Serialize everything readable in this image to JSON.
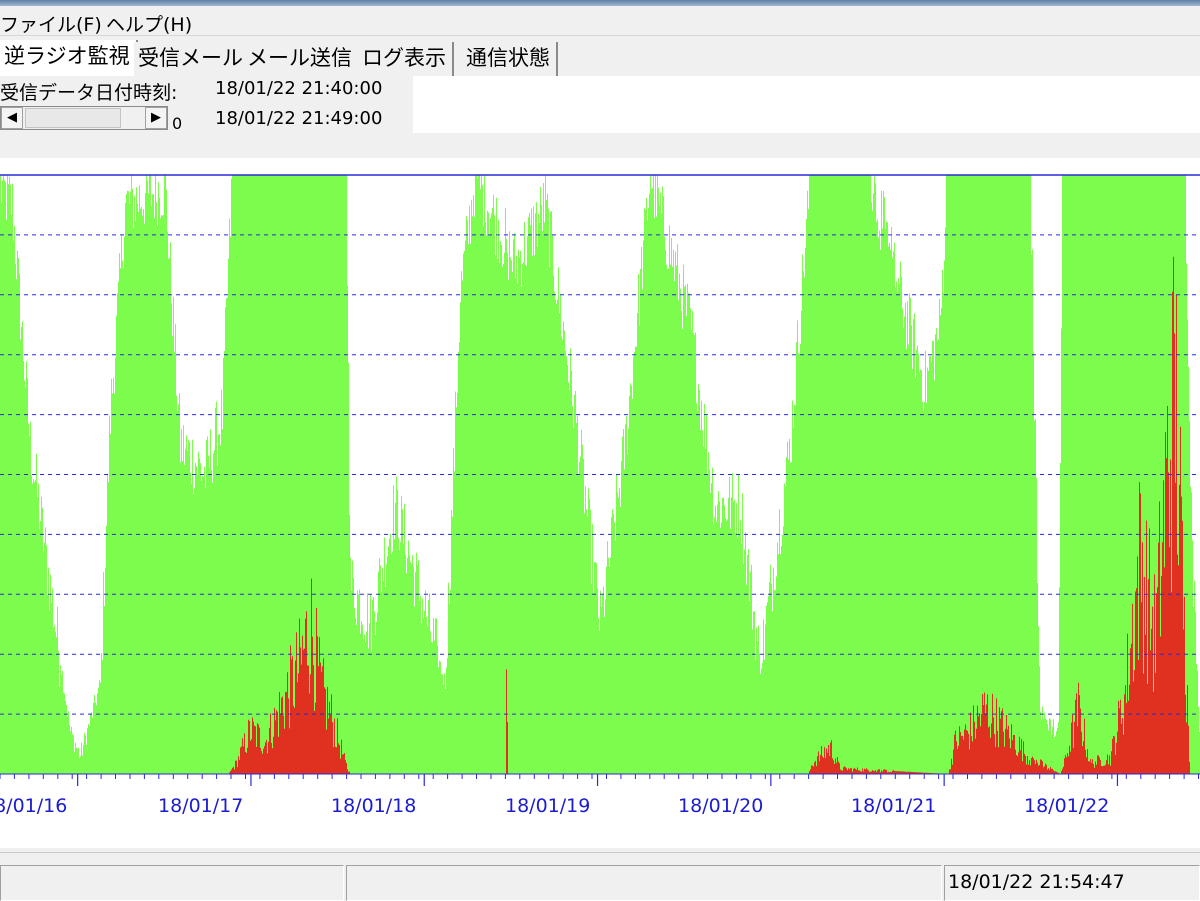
{
  "menu": {
    "items": [
      {
        "label": "ファイル(F)"
      },
      {
        "label": "ヘルプ(H)"
      }
    ]
  },
  "tabs": [
    {
      "label": "逆ラジオ監視",
      "active": true
    },
    {
      "label": "受信メール",
      "active": false
    },
    {
      "label": "メール送信",
      "active": false
    },
    {
      "label": "ログ表示",
      "active": false
    },
    {
      "label": "通信状態",
      "active": false
    }
  ],
  "info": {
    "label": "受信データ日付時刻:",
    "time_start": "18/01/22 21:40:00",
    "time_end": "18/01/22 21:49:00",
    "scroll_value": "0"
  },
  "chart_data": {
    "type": "area",
    "x_tick_labels": [
      "18/01/16",
      "18/01/17",
      "18/01/18",
      "18/01/19",
      "18/01/20",
      "18/01/21",
      "18/01/22"
    ],
    "colors": {
      "green": "#7cfc4c",
      "red": "#e03020",
      "grid": "#2a2ad8",
      "labels": "#1c1ccf"
    },
    "grid": true
  },
  "status": {
    "time": "18/01/22 21:54:47"
  }
}
